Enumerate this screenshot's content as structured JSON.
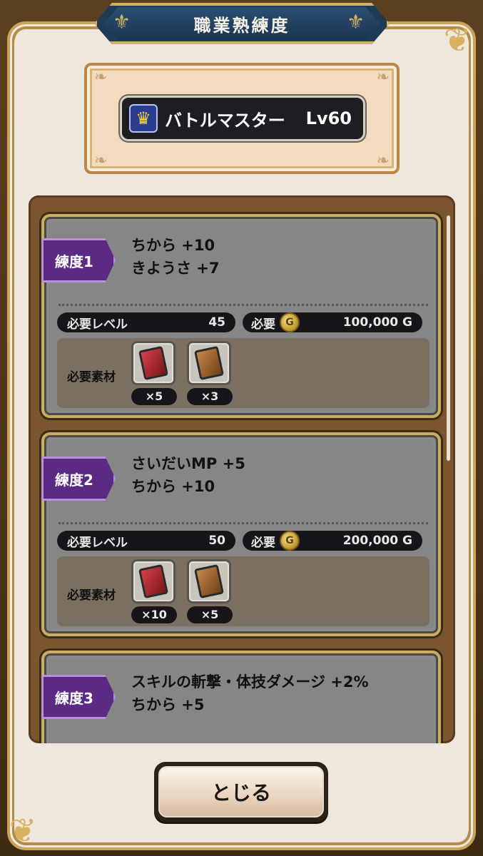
{
  "title": "職業熟練度",
  "job": {
    "name": "バトルマスター",
    "level": "Lv60",
    "icon": "job-crest-icon"
  },
  "cards": [
    {
      "tag": "練度1",
      "effects": [
        "ちから +10",
        "きようさ +7"
      ],
      "level_label": "必要レベル",
      "level_value": "45",
      "cost_label": "必要",
      "cost_value": "100,000 G",
      "materials_label": "必要素材",
      "materials": [
        {
          "icon": "red-card-icon",
          "count": "×5"
        },
        {
          "icon": "brown-card-icon",
          "count": "×3"
        }
      ]
    },
    {
      "tag": "練度2",
      "effects": [
        "さいだいMP +5",
        "ちから +10"
      ],
      "level_label": "必要レベル",
      "level_value": "50",
      "cost_label": "必要",
      "cost_value": "200,000 G",
      "materials_label": "必要素材",
      "materials": [
        {
          "icon": "red-card-icon",
          "count": "×10"
        },
        {
          "icon": "brown-card-icon",
          "count": "×5"
        }
      ]
    },
    {
      "tag": "練度3",
      "effects": [
        "スキルの斬撃・体技ダメージ +2%",
        "ちから +5"
      ]
    }
  ],
  "close_button": "とじる"
}
